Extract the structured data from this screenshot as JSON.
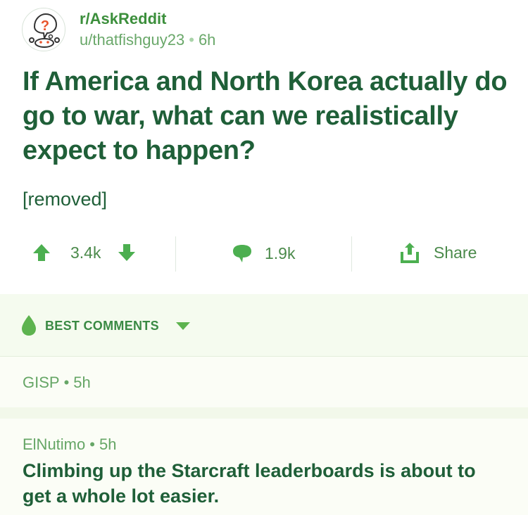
{
  "post": {
    "subreddit": "r/AskReddit",
    "author": "u/thatfishguy23",
    "age": "6h",
    "title": "If America and North Korea actually do go to war, what can we realistically expect to happen?",
    "body": "[removed]"
  },
  "actions": {
    "score": "3.4k",
    "comments": "1.9k",
    "share": "Share"
  },
  "comments_header": {
    "sort_label": "BEST COMMENTS"
  },
  "comments": [
    {
      "author": "GISP",
      "age": "5h",
      "body": ""
    },
    {
      "author": "ElNutimo",
      "age": "5h",
      "body": "Climbing up the Starcraft leaderboards is about to get a whole lot easier."
    }
  ],
  "colors": {
    "accent": "#4caf50",
    "title_text": "#1f5f38",
    "subreddit": "#3c8f3c",
    "panel_bg": "#f5fbef"
  },
  "icons": [
    "askreddit-avatar-icon",
    "upvote-icon",
    "downvote-icon",
    "comment-icon",
    "share-icon",
    "drop-icon",
    "chevron-down-icon"
  ]
}
